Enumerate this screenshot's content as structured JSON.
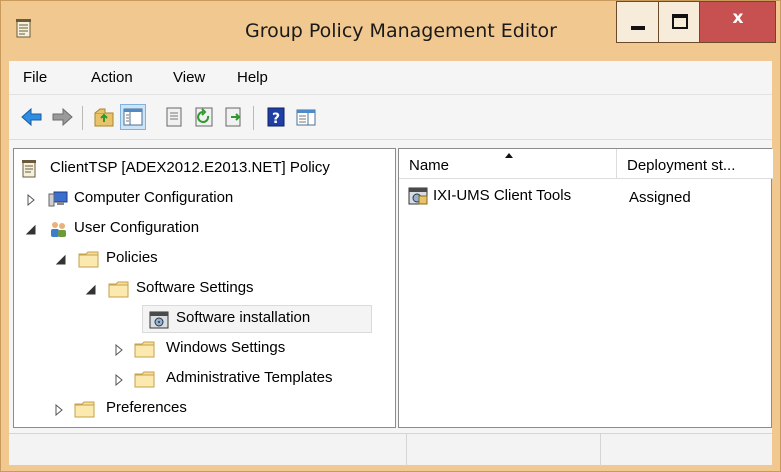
{
  "window": {
    "title": "Group Policy Management Editor",
    "close_glyph": "x",
    "colors": {
      "frame": "#f0c890",
      "close": "#c75050",
      "selection": "#cce4f7"
    }
  },
  "menu": {
    "items": [
      {
        "label": "File"
      },
      {
        "label": "Action"
      },
      {
        "label": "View"
      },
      {
        "label": "Help"
      }
    ]
  },
  "toolbar": {
    "icons": [
      "back-arrow-icon",
      "forward-arrow-icon",
      "up-folder-icon",
      "show-hide-tree-icon",
      "properties-icon",
      "refresh-icon",
      "export-list-icon",
      "help-icon",
      "extended-view-icon"
    ]
  },
  "tree": {
    "root": "ClientTSP [ADEX2012.E2013.NET] Policy",
    "computer_config": "Computer Configuration",
    "user_config": "User Configuration",
    "policies": "Policies",
    "software_settings": "Software Settings",
    "software_installation": "Software installation",
    "windows_settings": "Windows Settings",
    "admin_templates": "Administrative Templates",
    "preferences": "Preferences"
  },
  "list": {
    "columns": [
      {
        "label": "Name"
      },
      {
        "label": "Deployment st..."
      }
    ],
    "rows": [
      {
        "name": "IXI-UMS Client Tools",
        "deployment_state": "Assigned"
      }
    ]
  }
}
